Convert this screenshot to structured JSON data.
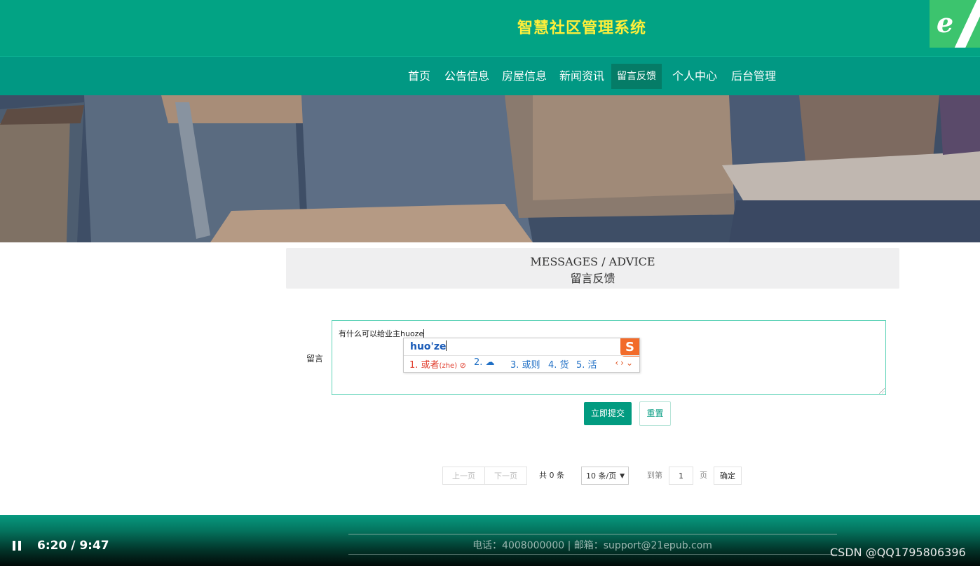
{
  "header": {
    "title": "智慧社区管理系统",
    "logo_icon": "ie-browser-icon"
  },
  "nav": {
    "items": [
      {
        "label": "首页"
      },
      {
        "label": "公告信息"
      },
      {
        "label": "房屋信息"
      },
      {
        "label": "新闻资讯"
      },
      {
        "label": "留言反馈",
        "active": true
      },
      {
        "label": "个人中心"
      },
      {
        "label": "后台管理"
      }
    ]
  },
  "section": {
    "title_en": "MESSAGES / ADVICE",
    "title_zh": "留言反馈"
  },
  "form": {
    "message_label": "留言",
    "message_value": "有什么可以给业主huoze",
    "submit_label": "立即提交",
    "reset_label": "重置"
  },
  "ime": {
    "pinyin": "huo'ze",
    "candidates": [
      "1. 或者",
      "(zhe)",
      "2.",
      "3. 或则",
      "4. 货",
      "5. 活"
    ],
    "logo_text": "S"
  },
  "pagination": {
    "prev_label": "上一页",
    "next_label": "下一页",
    "total_text": "共 0 条",
    "page_size": "10 条/页",
    "goto_label": "到第",
    "page_value": "1",
    "page_unit": "页",
    "confirm_label": "确定"
  },
  "footer": {
    "contact": "电话：4008000000 | 邮箱：support@21epub.com"
  },
  "player": {
    "time": "6:20 / 9:47"
  },
  "watermark": "CSDN @QQ1795806396",
  "colors": {
    "primary": "#02a384",
    "nav": "#019883",
    "title": "#ffef3a"
  }
}
